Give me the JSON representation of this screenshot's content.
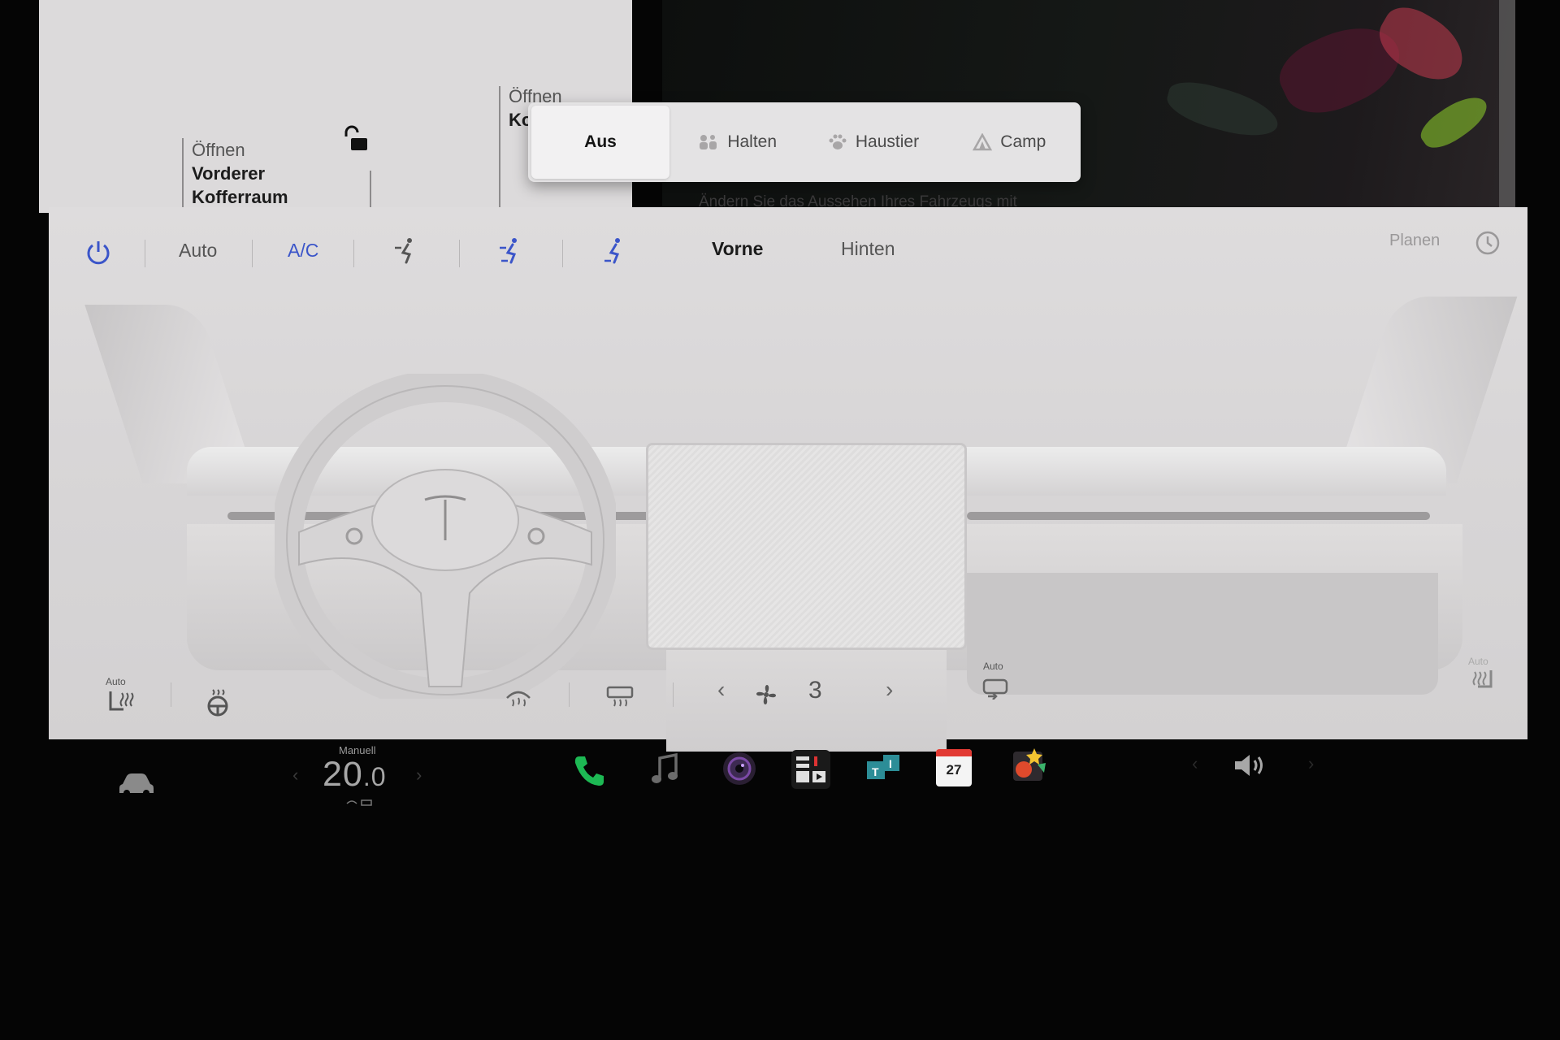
{
  "vehicle": {
    "frunk": {
      "line1": "Öffnen",
      "line2": "Vorderer",
      "line3": "Kofferraum"
    },
    "trunk": {
      "line1": "Öffnen",
      "line2": "Ko"
    },
    "background_text": "Ändern Sie das Aussehen Ihres Fahrzeugs mit"
  },
  "modes": [
    {
      "label": "Aus",
      "icon": "",
      "active": true
    },
    {
      "label": "Halten",
      "icon": "keep-icon",
      "active": false
    },
    {
      "label": "Haustier",
      "icon": "paw-icon",
      "active": false
    },
    {
      "label": "Camp",
      "icon": "tent-icon",
      "active": false
    }
  ],
  "climate": {
    "power_icon": "power-icon",
    "auto_label": "Auto",
    "ac_label": "A/C",
    "vents": [
      "airflow-face-icon",
      "airflow-face-feet-icon",
      "airflow-feet-icon"
    ],
    "tabs": [
      "Vorne",
      "Hinten"
    ],
    "active_tab": "Vorne",
    "schedule_label": "Planen",
    "fan_speed": "3",
    "seat_left_auto": "Auto",
    "recirc_auto": "Auto",
    "seat_right_auto": "Auto",
    "accent": "#3b55c9"
  },
  "bottom_bar": {
    "temp_mode": "Manuell",
    "temp_int": "20",
    "temp_dec": ".0",
    "calendar_day": "27",
    "apps": [
      "phone-icon",
      "music-icon",
      "camera-icon",
      "toybox-icon",
      "theater-icon",
      "calendar-icon",
      "arcade-icon"
    ],
    "phone_color": "#1db954"
  }
}
